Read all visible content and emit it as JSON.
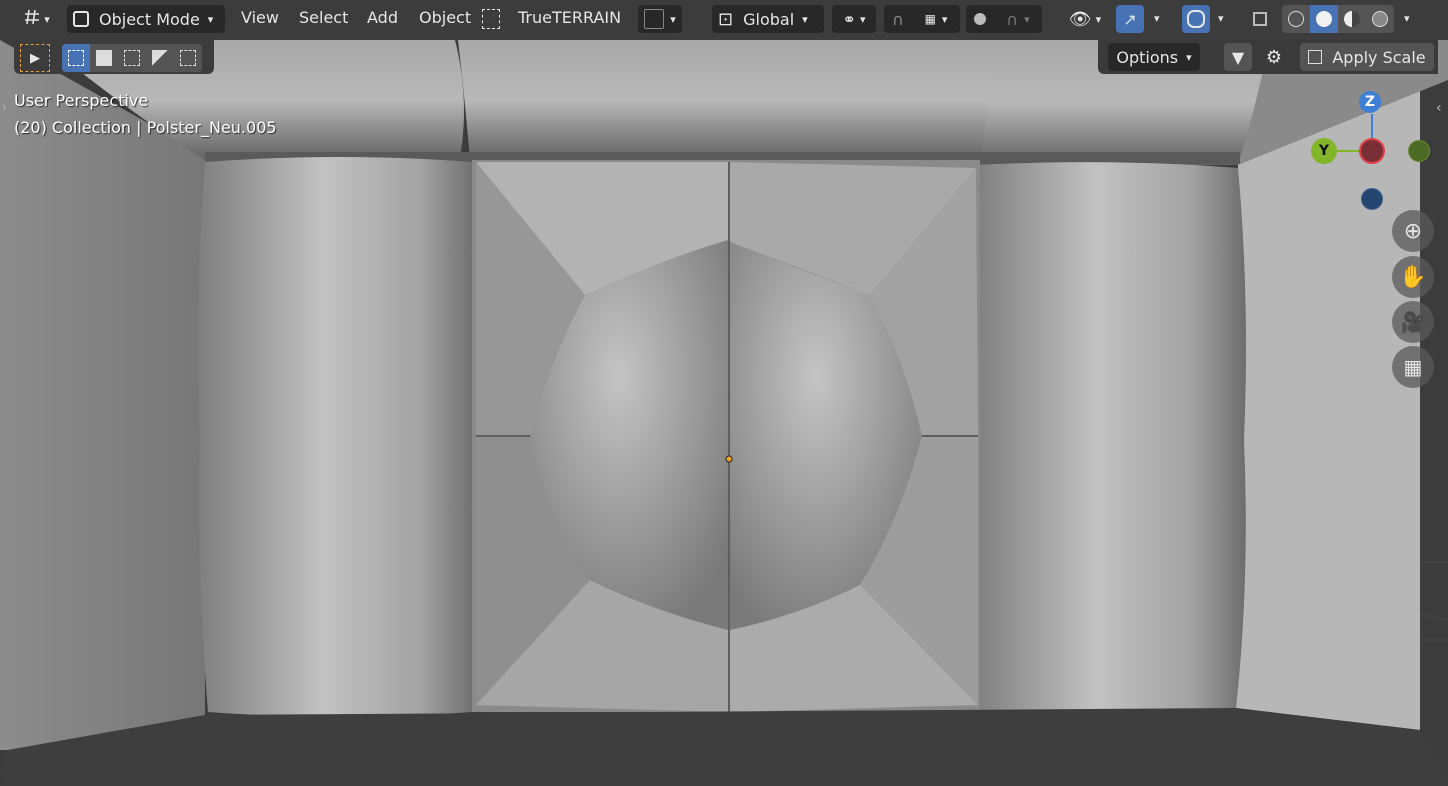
{
  "header": {
    "editor_icon": "editor-type-icon",
    "mode": "Object Mode",
    "menus": [
      "View",
      "Select",
      "Add",
      "Object"
    ],
    "addon_label": "TrueTERRAIN",
    "orientation": "Global",
    "options_label": "Options",
    "apply_scale_label": "Apply Scale"
  },
  "viewport": {
    "view_name": "User Perspective",
    "object_info": "(20) Collection | Polster_Neu.005"
  },
  "gizmo": {
    "z_label": "Z",
    "y_label": "Y",
    "colors": {
      "x": "#e2404a",
      "y": "#82b527",
      "z": "#3d7fd6",
      "neg_x": "#7a2e35",
      "neg_y": "#4d6a24",
      "neg_z": "#234770"
    }
  },
  "colors": {
    "accent": "#4772b3",
    "origin": "#f5a623"
  }
}
